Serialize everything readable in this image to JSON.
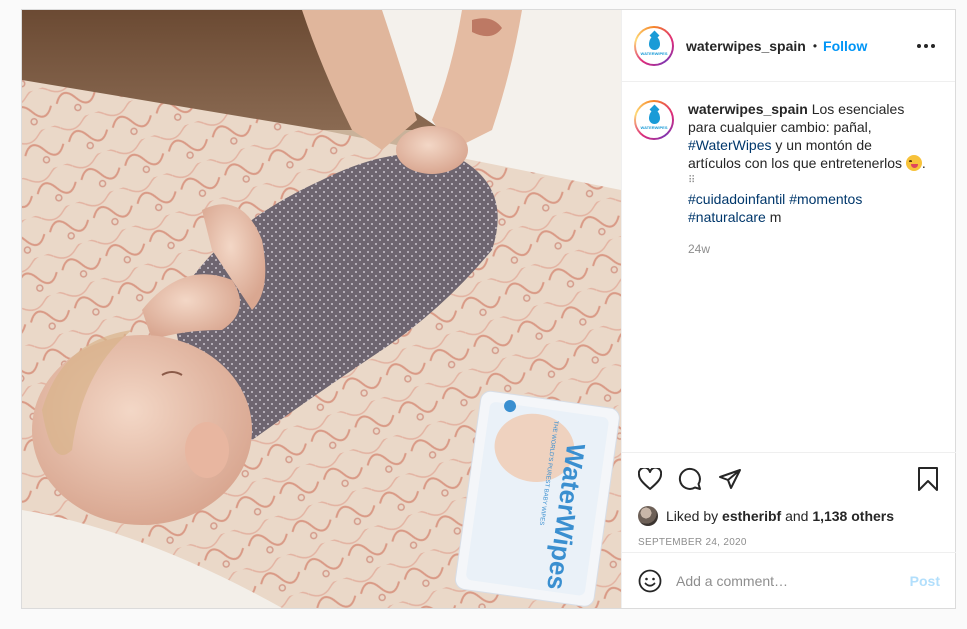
{
  "post": {
    "username": "waterwipes_spain",
    "follow_label": "Follow",
    "avatar_logo_text": "WATERWIPES",
    "caption": {
      "username": "waterwipes_spain",
      "text_1": " Los esenciales para cualquier cambio: pañal, ",
      "tag_1": "#WaterWipes",
      "text_2": " y un montón de artículos con los que entretenerlos ",
      "text_3": ".",
      "dots": "⠿",
      "tag_2": "#cuidadoinfantil",
      "tag_3": "#momentos",
      "tag_4": "#naturalcare",
      "text_4": " m",
      "time_ago": "24w"
    },
    "likes": {
      "prefix": "Liked by ",
      "liker": "estheribf",
      "middle": " and ",
      "others": "1,138 others"
    },
    "date": "SEPTEMBER 24, 2020",
    "comment": {
      "placeholder": "Add a comment…",
      "post_label": "Post"
    },
    "photo": {
      "product_brand_text": "WaterWipes",
      "product_tagline_text": "THE WORLD'S PUREST BABY WIPES"
    }
  },
  "colors": {
    "accent_blue": "#0095f6",
    "hashtag_blue": "#00376b",
    "secondary_gray": "#8e8e8e",
    "border": "#dbdbdb",
    "brand_blue": "#1a9bd7"
  },
  "icons": [
    "more-icon",
    "heart-icon",
    "comment-icon",
    "share-icon",
    "bookmark-icon",
    "emoji-icon"
  ]
}
